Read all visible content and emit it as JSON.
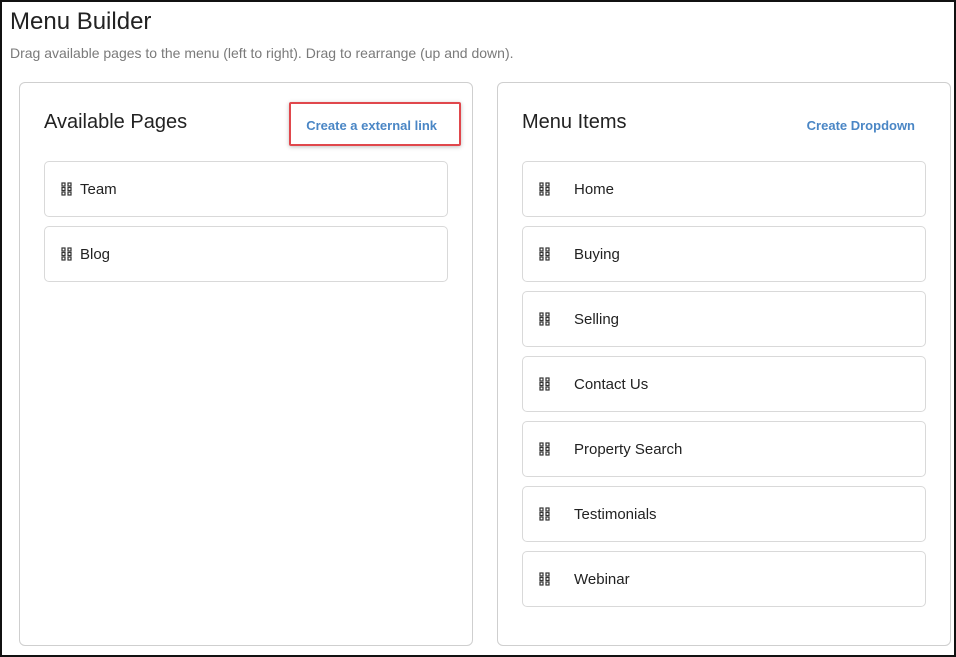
{
  "header": {
    "title": "Menu Builder",
    "subtitle": "Drag available pages to the menu (left to right). Drag to rearrange (up and down)."
  },
  "available_pages": {
    "title": "Available Pages",
    "action_label": "Create a external link",
    "items": [
      {
        "label": "Team",
        "icon": "drag-handle-icon"
      },
      {
        "label": "Blog",
        "icon": "drag-handle-icon"
      }
    ]
  },
  "menu_items": {
    "title": "Menu Items",
    "action_label": "Create Dropdown",
    "items": [
      {
        "label": "Home",
        "icon": "drag-handle-icon"
      },
      {
        "label": "Buying",
        "icon": "drag-handle-icon"
      },
      {
        "label": "Selling",
        "icon": "drag-handle-icon"
      },
      {
        "label": "Contact Us",
        "icon": "drag-handle-icon"
      },
      {
        "label": "Property Search",
        "icon": "drag-handle-icon"
      },
      {
        "label": "Testimonials",
        "icon": "drag-handle-icon"
      },
      {
        "label": "Webinar",
        "icon": "drag-handle-icon"
      }
    ]
  },
  "colors": {
    "link": "#4a86c5",
    "highlight": "#e0474c",
    "border": "#d9d9d9"
  }
}
